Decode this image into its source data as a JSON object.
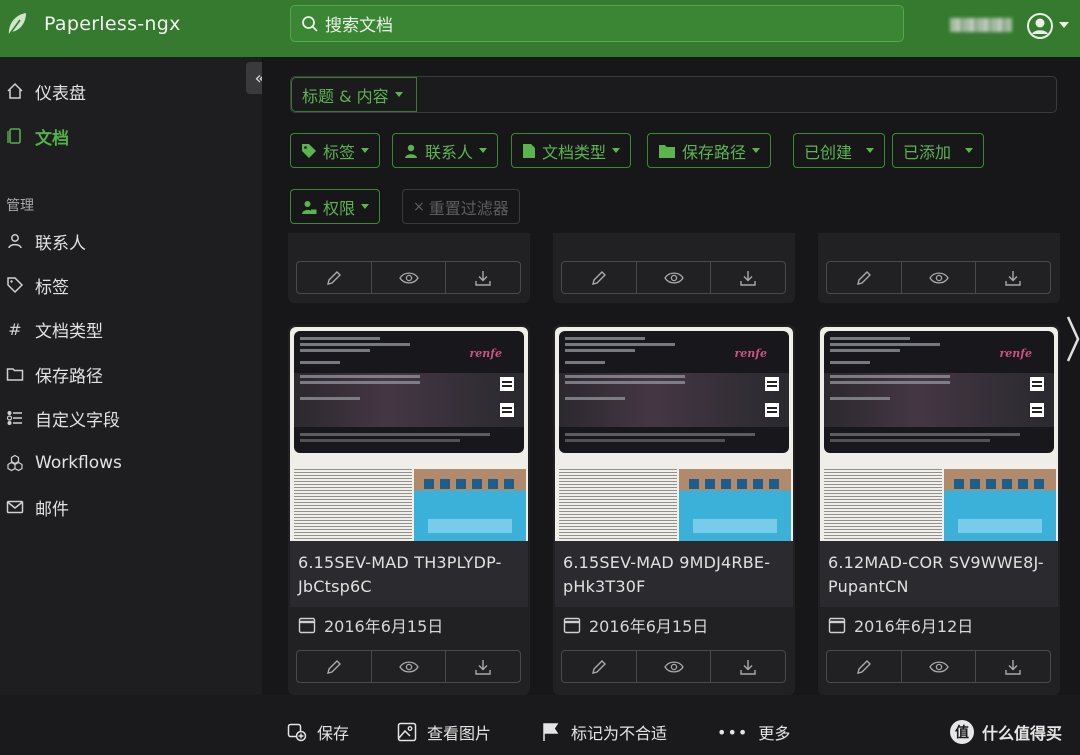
{
  "header": {
    "app_title": "Paperless-ngx",
    "search_placeholder": "搜索文档",
    "brand_color": "#367a30"
  },
  "sidebar": {
    "items": [
      {
        "label": "仪表盘",
        "icon": "house-icon"
      },
      {
        "label": "文档",
        "icon": "document-icon",
        "active": true
      }
    ],
    "section_label": "管理",
    "manage_items": [
      {
        "label": "联系人",
        "icon": "person-icon"
      },
      {
        "label": "标签",
        "icon": "tag-icon"
      },
      {
        "label": "文档类型",
        "icon": "hash-icon"
      },
      {
        "label": "保存路径",
        "icon": "folder-icon"
      },
      {
        "label": "自定义字段",
        "icon": "ui-radios-icon"
      },
      {
        "label": "Workflows",
        "icon": "boxes-icon"
      },
      {
        "label": "邮件",
        "icon": "envelope-icon"
      }
    ],
    "collapse_glyph": "«"
  },
  "filters": {
    "title_content": "标题 & 内容",
    "tags": "标签",
    "correspondent": "联系人",
    "document_type": "文档类型",
    "storage_path": "保存路径",
    "created": "已创建",
    "added": "已添加",
    "permissions": "权限",
    "reset": "重置过滤器"
  },
  "documents": [
    {
      "title": "6.15SEV-MAD TH3PLYDP-JbCtsp6C",
      "date": "2016年6月15日",
      "ticket_brand": "renfe"
    },
    {
      "title": "6.15SEV-MAD 9MDJ4RBE-pHk3T30F",
      "date": "2016年6月15日",
      "ticket_brand": "renfe"
    },
    {
      "title": "6.12MAD-COR SV9WWE8J-PupantCN",
      "date": "2016年6月12日",
      "ticket_brand": "renfe"
    }
  ],
  "bottom_bar": {
    "save": "保存",
    "view_image": "查看图片",
    "mark_unsuitable": "标记为不合适",
    "more": "更多",
    "watermark_badge": "值",
    "watermark_text": "什么值得买"
  }
}
